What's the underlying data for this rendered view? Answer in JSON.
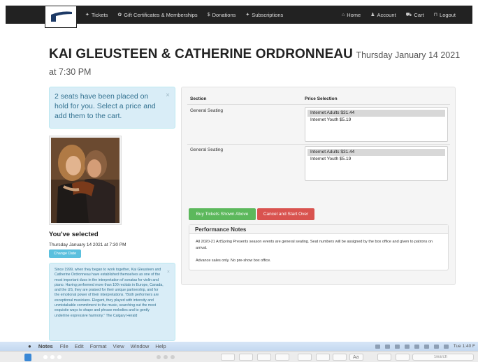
{
  "nav": {
    "left": [
      {
        "icon": "ticket-icon",
        "glyph": "✦",
        "label": "Tickets"
      },
      {
        "icon": "gift-icon",
        "glyph": "✿",
        "label": "Gift Certificates & Memberships"
      },
      {
        "icon": "dollar-icon",
        "glyph": "$",
        "label": "Donations"
      },
      {
        "icon": "tag-icon",
        "glyph": "✦",
        "label": "Subscriptions"
      }
    ],
    "right": [
      {
        "icon": "home-icon",
        "glyph": "⌂",
        "label": "Home"
      },
      {
        "icon": "user-icon",
        "glyph": "♟",
        "label": "Account"
      },
      {
        "icon": "cart-icon",
        "glyph": "⛟",
        "label": "Cart"
      },
      {
        "icon": "lock-icon",
        "glyph": "⊓",
        "label": "Logout"
      }
    ]
  },
  "event": {
    "performer": "KAI GLEUSTEEN & CATHERINE ORDRONNEAU",
    "date": "Thursday January 14 2021 at 7:30 PM"
  },
  "hold_notice": {
    "text": "2 seats have been placed on hold for you. Select a price and add them to the cart.",
    "close": "×"
  },
  "selected": {
    "title": "You've selected",
    "date": "Thursday January 14 2021 at 7:30 PM",
    "change_label": "Change Date"
  },
  "bio": {
    "text": "Since 1999, when they began to work together, Kai Gleusteen and Catherine Ordronneau have established themselves as one of the most important duos in the interpretation of sonatas for violin and piano. Having performed more than 100 recitals in Europe, Canada, and the US, they are praised for their unique partnership, and for the emotional power of their interpretations. \"Both performers are exceptional musicians. Elegant, they played with intensity and unmistakable commitment to the music, searching out the most exquisite ways to shape and phrase melodies and to gently underline expressive harmony.\" The Calgary Herald",
    "close": "×"
  },
  "table": {
    "col_section": "Section",
    "col_price": "Price Selection",
    "rows": [
      {
        "section": "General Seating",
        "options": [
          "Internet Adults $31.44",
          "Internet Youth $5.19"
        ]
      },
      {
        "section": "General Seating",
        "options": [
          "Internet Adults $31.44",
          "Internet Youth $5.19"
        ]
      }
    ]
  },
  "actions": {
    "buy_label": "Buy Tickets Shown Above",
    "cancel_label": "Cancel and Start Over"
  },
  "notes": {
    "title": "Performance Notes",
    "paragraph1": "All 2020-21 ArtSpring Presents season events are general seating. Seat numbers will be assigned by the box office and given to patrons on arrival.",
    "paragraph2": "Advance sales only. No pre-show box office."
  },
  "mac_menubar": {
    "app": "Notes",
    "items": [
      "File",
      "Edit",
      "Format",
      "View",
      "Window",
      "Help"
    ],
    "clock": "Tue 1:40 F"
  },
  "notes_toolbar": {
    "search_placeholder": "Search",
    "format_button": "Aa"
  },
  "colors": {
    "nav_bg": "#222222",
    "info_bg": "#d9edf7",
    "info_text": "#31708f",
    "buy": "#5cb85c",
    "cancel": "#d9534f",
    "change": "#5bc0de"
  }
}
